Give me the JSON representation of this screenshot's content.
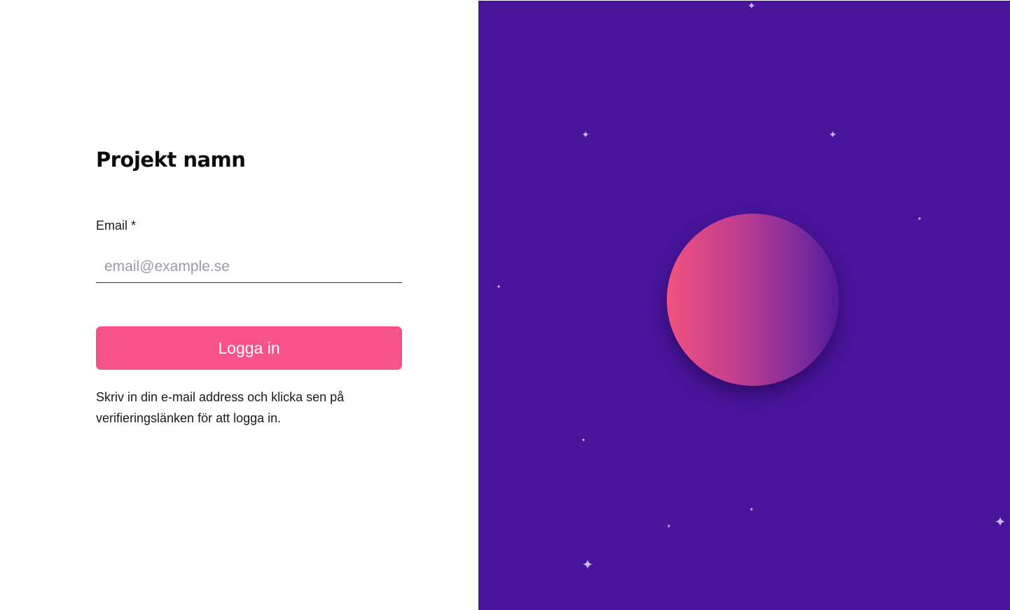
{
  "login": {
    "title": "Projekt namn",
    "email_label": "Email *",
    "email_value": "",
    "email_placeholder": "email@example.se",
    "login_button": "Logga in",
    "help_text": "Skriv in din e-mail address och klicka sen på verifieringslänken för att logga in."
  },
  "illustration": {
    "background_color": "#48149a",
    "planet_gradient": [
      "#f2527f",
      "#53189a"
    ],
    "star_icon": "sparkle-icon",
    "star_glyph": "✦"
  },
  "colors": {
    "accent": "#f7528a",
    "input_underline": "#4d1a6b"
  }
}
